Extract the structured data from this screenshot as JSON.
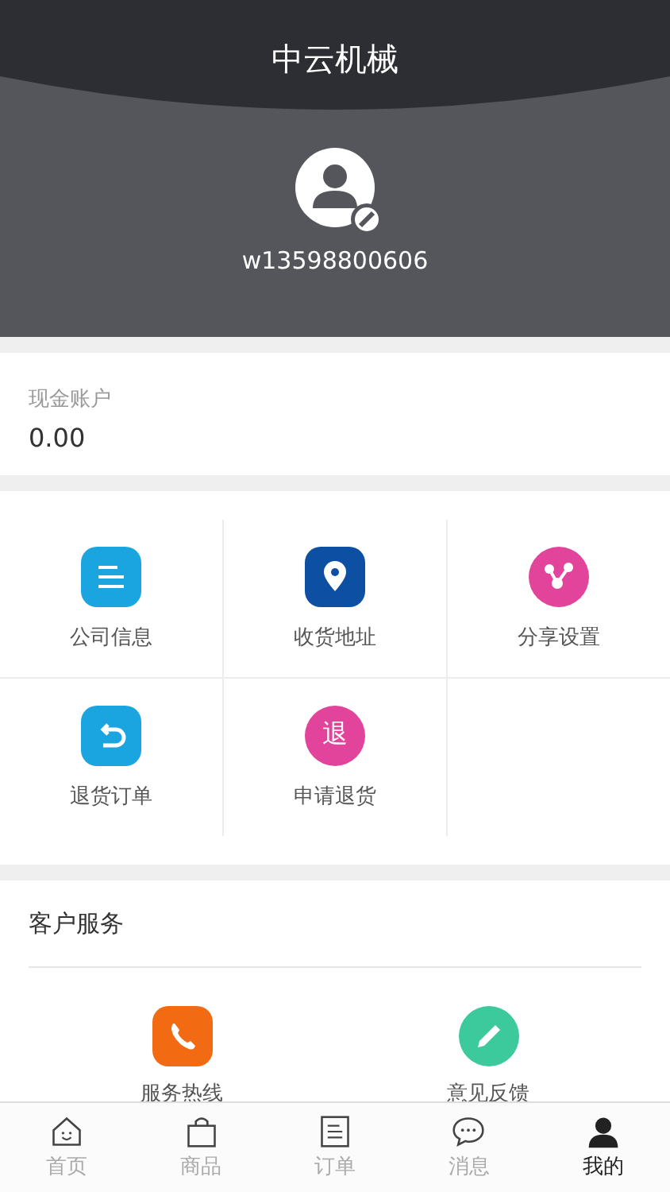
{
  "header": {
    "title": "中云机械",
    "username": "w13598800606"
  },
  "account": {
    "label": "现金账户",
    "value": "0.00"
  },
  "features": [
    {
      "label": "公司信息",
      "kind": "info"
    },
    {
      "label": "收货地址",
      "kind": "location"
    },
    {
      "label": "分享设置",
      "kind": "share"
    },
    {
      "label": "退货订单",
      "kind": "return"
    },
    {
      "label": "申请退货",
      "kind": "refund",
      "glyph": "退"
    }
  ],
  "service": {
    "title": "客户服务",
    "items": [
      {
        "label": "服务热线",
        "kind": "phone"
      },
      {
        "label": "意见反馈",
        "kind": "feedback"
      }
    ]
  },
  "tabs": [
    {
      "label": "首页",
      "kind": "home",
      "selected": false
    },
    {
      "label": "商品",
      "kind": "bag",
      "selected": false
    },
    {
      "label": "订单",
      "kind": "order",
      "selected": false
    },
    {
      "label": "消息",
      "kind": "message",
      "selected": false
    },
    {
      "label": "我的",
      "kind": "me",
      "selected": true
    }
  ]
}
